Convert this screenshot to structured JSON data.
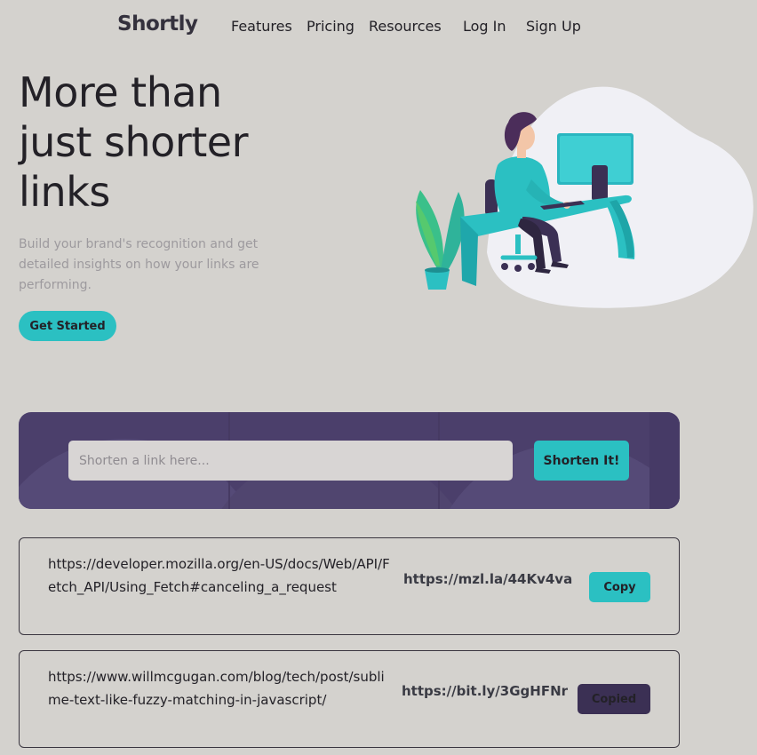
{
  "nav": {
    "logo": "Shortly",
    "links": [
      "Features",
      "Pricing",
      "Resources"
    ],
    "login": "Log In",
    "signup": "Sign Up"
  },
  "hero": {
    "title_lines": [
      "More than",
      "just shorter",
      "links"
    ],
    "subtitle": "Build your brand's recognition and get detailed insights on how your links are performing.",
    "cta": "Get Started"
  },
  "shortener": {
    "placeholder": "Shorten a link here...",
    "value": "",
    "button": "Shorten It!"
  },
  "results": [
    {
      "long_url": "https://developer.mozilla.org/en-US/docs/Web/API/Fetch_API/Using_Fetch#canceling_a_request",
      "short_url": "https://mzl.la/44Kv4va",
      "button": "Copy",
      "state": "default"
    },
    {
      "long_url": "https://www.willmcgugan.com/blog/tech/post/sublime-text-like-fuzzy-matching-in-javascript/",
      "short_url": "https://bit.ly/3GgHFNr",
      "button": "Copied",
      "state": "copied"
    }
  ],
  "colors": {
    "background": "#d4d2ce",
    "accent": "#2bc0c2",
    "dark_violet": "#4b3f6b",
    "copied": "#3b3054",
    "text": "#232127"
  }
}
